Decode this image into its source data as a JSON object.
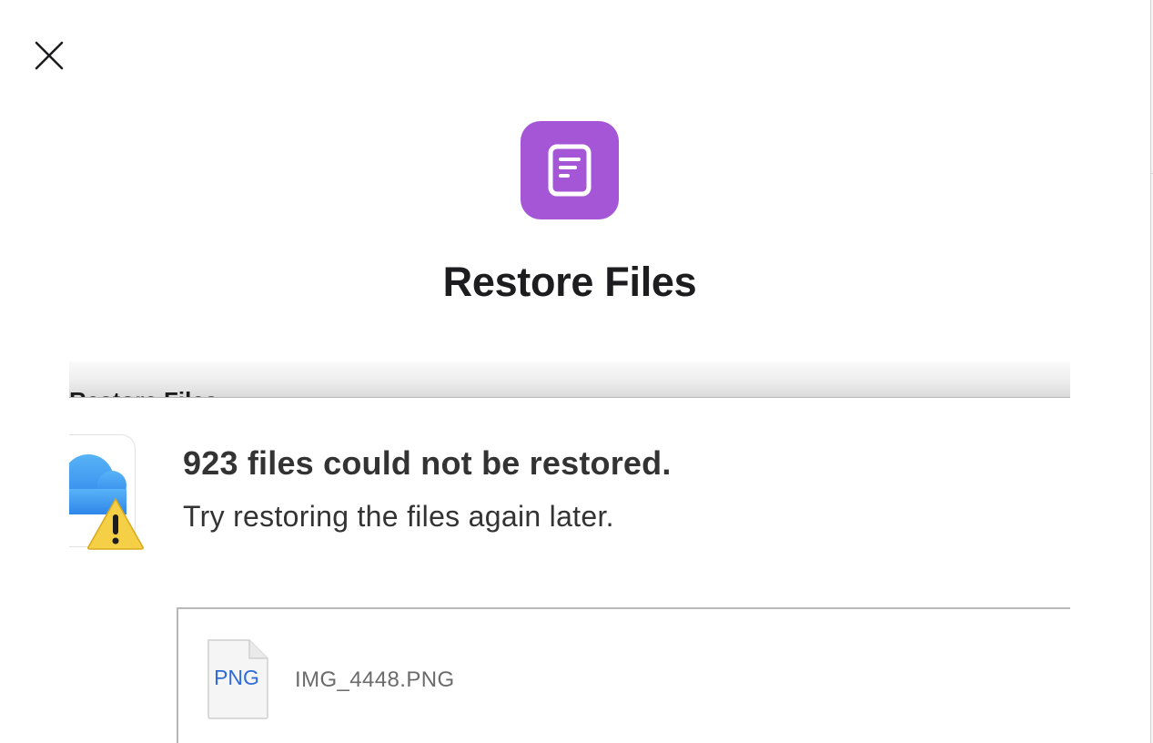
{
  "sheet": {
    "close_icon": "close-x-icon",
    "app_icon": "document-icon",
    "app_icon_color": "#a456d6",
    "title": "Restore Files"
  },
  "dialog": {
    "header_title": "Restore Files",
    "alert_icon": "icloud-warning-icon",
    "alert_title": "923 files could not be restored.",
    "alert_subtitle": "Try restoring the files again later.",
    "files": [
      {
        "type": "PNG",
        "name": "IMG_4448.PNG",
        "type_color": "#2f6bd8"
      }
    ]
  }
}
